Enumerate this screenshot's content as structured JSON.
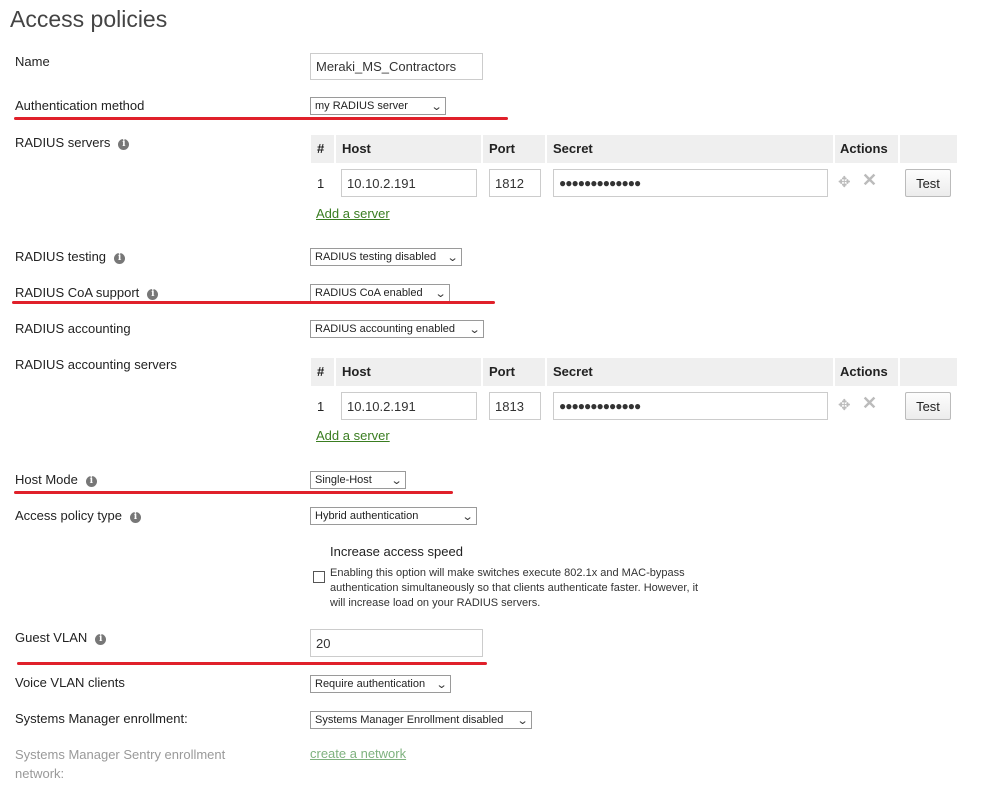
{
  "page": {
    "title": "Access policies"
  },
  "name": {
    "label": "Name",
    "value": "Meraki_MS_Contractors"
  },
  "auth_method": {
    "label": "Authentication method",
    "value": "my RADIUS server"
  },
  "radius_servers": {
    "label": "RADIUS servers",
    "columns": [
      "#",
      "Host",
      "Port",
      "Secret",
      "Actions"
    ],
    "rows": [
      {
        "num": "1",
        "host": "10.10.2.191",
        "port": "1812",
        "secret": "●●●●●●●●●●●●●",
        "test": "Test"
      }
    ],
    "add_link": "Add a server"
  },
  "radius_testing": {
    "label": "RADIUS testing",
    "value": "RADIUS testing disabled"
  },
  "radius_coa": {
    "label": "RADIUS CoA support",
    "value": "RADIUS CoA enabled"
  },
  "radius_accounting": {
    "label": "RADIUS accounting",
    "value": "RADIUS accounting enabled"
  },
  "radius_accounting_servers": {
    "label": "RADIUS accounting servers",
    "columns": [
      "#",
      "Host",
      "Port",
      "Secret",
      "Actions"
    ],
    "rows": [
      {
        "num": "1",
        "host": "10.10.2.191",
        "port": "1813",
        "secret": "●●●●●●●●●●●●●",
        "test": "Test"
      }
    ],
    "add_link": "Add a server"
  },
  "host_mode": {
    "label": "Host Mode",
    "value": "Single-Host"
  },
  "access_policy_type": {
    "label": "Access policy type",
    "value": "Hybrid authentication"
  },
  "increase_speed": {
    "title": "Increase access speed",
    "description": "Enabling this option will make switches execute 802.1x and MAC-bypass authentication simultaneously so that clients authenticate faster. However, it will increase load on your RADIUS servers.",
    "checked": false
  },
  "guest_vlan": {
    "label": "Guest VLAN",
    "value": "20"
  },
  "voice_vlan": {
    "label": "Voice VLAN clients",
    "value": "Require authentication"
  },
  "sm_enrollment": {
    "label": "Systems Manager enrollment:",
    "value": "Systems Manager Enrollment disabled"
  },
  "sm_sentry": {
    "label": "Systems Manager Sentry enrollment network:",
    "link": "create a network"
  },
  "icons": {
    "info": "info-icon",
    "move": "move-icon",
    "delete": "delete-icon",
    "dropdown": "chevron-down-icon"
  },
  "colors": {
    "highlight_underline": "#e0202a",
    "link": "#3a7d21"
  }
}
